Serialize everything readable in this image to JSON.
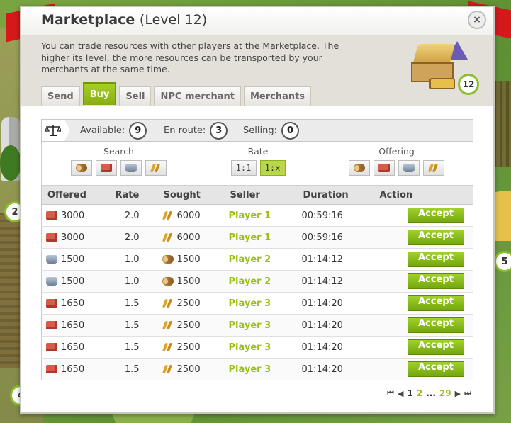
{
  "map": {
    "badges": [
      "2",
      "5",
      "4"
    ]
  },
  "dialog": {
    "title": "Marketplace",
    "level_label": "(Level 12)",
    "close_label": "×",
    "intro": "You can trade resources with other players at the Marketplace. The higher its level, the more resources can be transported by your merchants at the same time.",
    "building_level": "12"
  },
  "tabs": [
    {
      "label": "Send",
      "active": false
    },
    {
      "label": "Buy",
      "active": true
    },
    {
      "label": "Sell",
      "active": false
    },
    {
      "label": "NPC merchant",
      "active": false
    },
    {
      "label": "Merchants",
      "active": false
    }
  ],
  "stats": {
    "available_label": "Available:",
    "available_value": "9",
    "en_route_label": "En route:",
    "en_route_value": "3",
    "selling_label": "Selling:",
    "selling_value": "0"
  },
  "filters": {
    "search_title": "Search",
    "rate_title": "Rate",
    "offering_title": "Offering",
    "resources": [
      "wood-icon",
      "clay-icon",
      "iron-icon",
      "crop-icon"
    ],
    "rate_options": [
      "1:1",
      "1:x"
    ],
    "rate_selected": "1:x"
  },
  "table": {
    "headers": {
      "offered": "Offered",
      "rate": "Rate",
      "sought": "Sought",
      "seller": "Seller",
      "duration": "Duration",
      "action": "Action"
    },
    "accept_label": "Accept",
    "rows": [
      {
        "offered_res": "clay",
        "offered": "3000",
        "rate": "2.0",
        "sought_res": "crop",
        "sought": "6000",
        "seller": "Player 1",
        "duration": "00:59:16"
      },
      {
        "offered_res": "clay",
        "offered": "3000",
        "rate": "2.0",
        "sought_res": "crop",
        "sought": "6000",
        "seller": "Player 1",
        "duration": "00:59:16"
      },
      {
        "offered_res": "iron",
        "offered": "1500",
        "rate": "1.0",
        "sought_res": "wood",
        "sought": "1500",
        "seller": "Player 2",
        "duration": "01:14:12"
      },
      {
        "offered_res": "iron",
        "offered": "1500",
        "rate": "1.0",
        "sought_res": "wood",
        "sought": "1500",
        "seller": "Player 2",
        "duration": "01:14:12"
      },
      {
        "offered_res": "clay",
        "offered": "1650",
        "rate": "1.5",
        "sought_res": "crop",
        "sought": "2500",
        "seller": "Player 3",
        "duration": "01:14:20"
      },
      {
        "offered_res": "clay",
        "offered": "1650",
        "rate": "1.5",
        "sought_res": "crop",
        "sought": "2500",
        "seller": "Player 3",
        "duration": "01:14:20"
      },
      {
        "offered_res": "clay",
        "offered": "1650",
        "rate": "1.5",
        "sought_res": "crop",
        "sought": "2500",
        "seller": "Player 3",
        "duration": "01:14:20"
      },
      {
        "offered_res": "clay",
        "offered": "1650",
        "rate": "1.5",
        "sought_res": "crop",
        "sought": "2500",
        "seller": "Player 3",
        "duration": "01:14:20"
      }
    ]
  },
  "pagination": {
    "first": "⏮",
    "prev": "◀",
    "current": "1",
    "next_page": "2",
    "ellipsis": "...",
    "last_page": "29",
    "next": "▶",
    "last": "⏭"
  }
}
